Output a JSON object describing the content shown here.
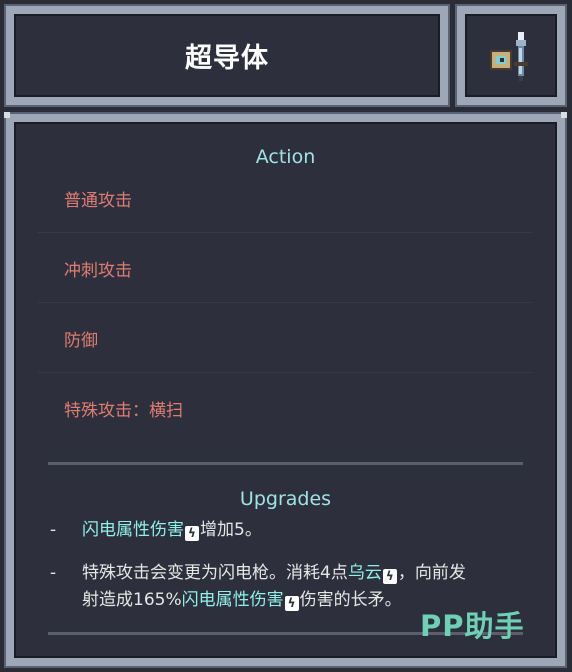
{
  "header": {
    "title": "超导体",
    "weapon_icon": "lightning-spear-icon"
  },
  "action": {
    "section_title": "Action",
    "rows": [
      "普通攻击",
      "冲刺攻击",
      "防御",
      "特殊攻击：横扫"
    ]
  },
  "upgrades": {
    "section_title": "Upgrades",
    "bullet": "-",
    "line1": {
      "part1": "闪电属性伤害",
      "icon1": "lightning-element-icon",
      "part2": "增加5。"
    },
    "line2": {
      "row1_a": "特殊攻击会变更为闪电枪。消耗4点",
      "row1_b": "乌云",
      "icon_cloud": "storm-cloud-icon",
      "row1_c": "，向前发",
      "row2_a": "射造成165%",
      "row2_b": "闪电属性伤害",
      "icon2": "lightning-element-icon",
      "row2_c": "伤害的长矛。"
    }
  },
  "watermark": "PP助手",
  "colors": {
    "background": "#2d303c",
    "frame": "#9ea7b7",
    "action_text": "#e07c73",
    "section_title": "#9fe3e3",
    "highlight": "#8ff0e8",
    "body_text": "#e6e6e6"
  }
}
